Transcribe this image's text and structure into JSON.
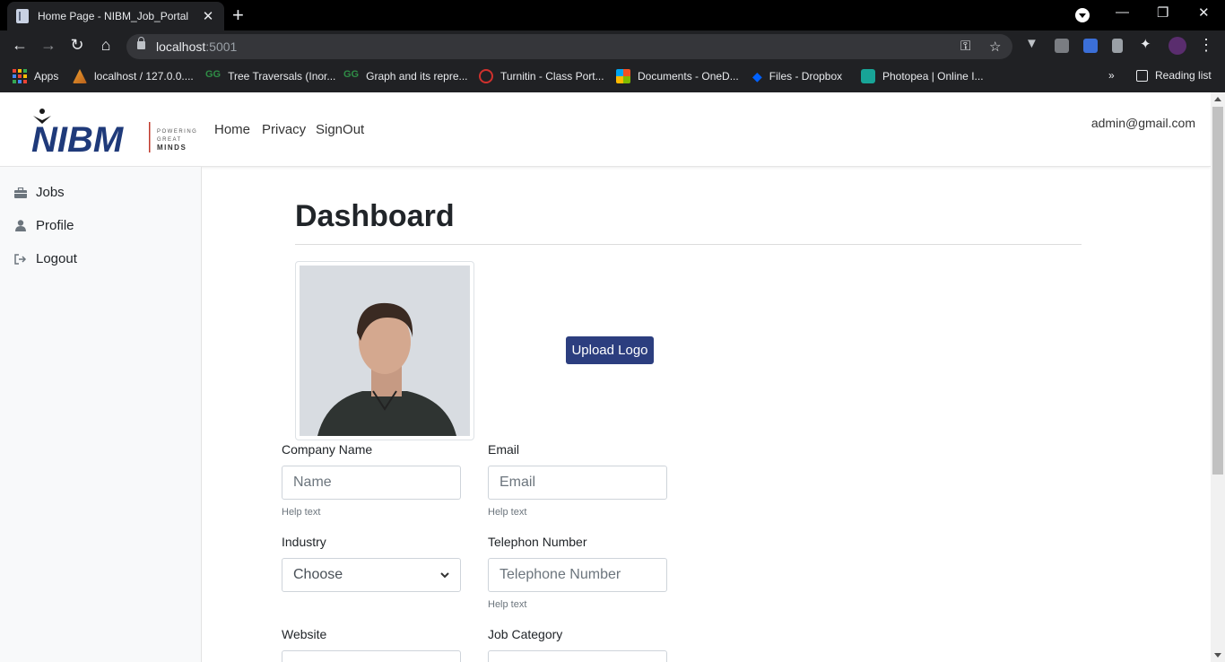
{
  "browser": {
    "tab_title": "Home Page - NIBM_Job_Portal",
    "url_host": "localhost",
    "url_port": ":5001",
    "bookmarks": [
      "Apps",
      "localhost / 127.0.0....",
      "Tree Traversals (Inor...",
      "Graph and its repre...",
      "Turnitin - Class Port...",
      "Documents - OneD...",
      "Files - Dropbox",
      "Photopea | Online I..."
    ],
    "reading_list": "Reading list",
    "overflow": "»"
  },
  "navbar": {
    "logo_text": "NIBM",
    "logo_tagline": [
      "POWERING",
      "GREAT",
      "MINDS"
    ],
    "links": [
      "Home",
      "Privacy",
      "SignOut"
    ],
    "user_email": "admin@gmail.com"
  },
  "sidebar": {
    "items": [
      {
        "label": "Jobs",
        "icon": "briefcase-icon"
      },
      {
        "label": "Profile",
        "icon": "user-icon"
      },
      {
        "label": "Logout",
        "icon": "sign-out-icon"
      }
    ]
  },
  "main": {
    "title": "Dashboard",
    "upload_button": "Upload Logo",
    "form": {
      "company_name": {
        "label": "Company Name",
        "placeholder": "Name",
        "help": "Help text"
      },
      "email": {
        "label": "Email",
        "placeholder": "Email",
        "help": "Help text"
      },
      "industry": {
        "label": "Industry",
        "selected": "Choose"
      },
      "telephone": {
        "label": "Telephon Number",
        "placeholder": "Telephone Number",
        "help": "Help text"
      },
      "website": {
        "label": "Website"
      },
      "job_category": {
        "label": "Job Category"
      }
    }
  },
  "colors": {
    "primary_button": "#2c3e7f",
    "logo_blue": "#1f3a7a",
    "logo_red": "#c0392b"
  }
}
